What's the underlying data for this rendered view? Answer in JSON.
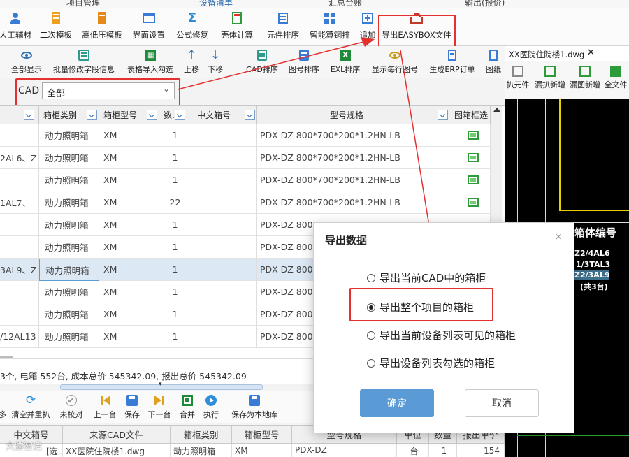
{
  "top_strip": {
    "items": [
      "项目管理",
      "设备清单",
      "汇总台账",
      "输出(报价)"
    ]
  },
  "ribbon1": {
    "buttons": [
      {
        "label": "人工辅材",
        "icon": "person-icon"
      },
      {
        "label": "二次模板",
        "icon": "template-icon"
      },
      {
        "label": "高低压模板",
        "icon": "template-icon"
      },
      {
        "label": "界面设置",
        "icon": "window-icon"
      },
      {
        "label": "公式修复",
        "icon": "sigma-icon"
      },
      {
        "label": "壳体计算",
        "icon": "calculator-icon"
      },
      {
        "label": "元件排序",
        "icon": "list-icon"
      },
      {
        "label": "智能算铜排",
        "icon": "grid-icon"
      },
      {
        "label": "追加",
        "icon": "plus-icon"
      },
      {
        "label": "导出EASYBOX文件",
        "icon": "export-icon"
      }
    ]
  },
  "ribbon2": {
    "buttons": [
      {
        "label": "全部显示",
        "icon": "eye-icon"
      },
      {
        "label": "批量修改字段信息",
        "icon": "edit-icon"
      },
      {
        "label": "表格导入勾选",
        "icon": "excel-icon"
      },
      {
        "label": "上移",
        "icon": "arrow-up-icon"
      },
      {
        "label": "下移",
        "icon": "arrow-down-icon"
      },
      {
        "label": "CAD排序",
        "icon": "cad-icon"
      },
      {
        "label": "图号排序",
        "icon": "list-icon"
      },
      {
        "label": "EXL排序",
        "icon": "excel-icon"
      },
      {
        "label": "显示每行图号",
        "icon": "eye-icon"
      },
      {
        "label": "生成ERP订单",
        "icon": "document-icon"
      },
      {
        "label": "图纸",
        "icon": "document-icon"
      }
    ]
  },
  "filter": {
    "label": "CAD",
    "value": "全部"
  },
  "grid": {
    "headers": [
      "箱柜类别",
      "箱柜型号",
      "数...",
      "中文箱号",
      "型号规格",
      "图箱框选"
    ],
    "rows": [
      {
        "name": "",
        "category": "动力照明箱",
        "model": "XM",
        "qty": "1",
        "cn": "",
        "spec": "PDX-DZ 800*700*200*1.2HN-LB"
      },
      {
        "name": "2AL6、Z",
        "category": "动力照明箱",
        "model": "XM",
        "qty": "1",
        "cn": "",
        "spec": "PDX-DZ 800*700*200*1.2HN-LB"
      },
      {
        "name": "",
        "category": "动力照明箱",
        "model": "XM",
        "qty": "1",
        "cn": "",
        "spec": "PDX-DZ 800*700*200*1.2HN-LB"
      },
      {
        "name": "1AL7、",
        "category": "动力照明箱",
        "model": "XM",
        "qty": "22",
        "cn": "",
        "spec": "PDX-DZ 800*700*200*1.2HN-LB"
      },
      {
        "name": "",
        "category": "动力照明箱",
        "model": "XM",
        "qty": "1",
        "cn": "",
        "spec": "PDX-DZ 800"
      },
      {
        "name": "",
        "category": "动力照明箱",
        "model": "XM",
        "qty": "1",
        "cn": "",
        "spec": "PDX-DZ 800"
      },
      {
        "name": "3AL9、Z",
        "category": "动力照明箱",
        "model": "XM",
        "qty": "1",
        "cn": "",
        "spec": "PDX-DZ 800"
      },
      {
        "name": "",
        "category": "动力照明箱",
        "model": "XM",
        "qty": "1",
        "cn": "",
        "spec": "PDX-DZ 800"
      },
      {
        "name": "",
        "category": "动力照明箱",
        "model": "XM",
        "qty": "1",
        "cn": "",
        "spec": "PDX-DZ 800"
      },
      {
        "name": "/12AL13",
        "category": "动力照明箱",
        "model": "XM",
        "qty": "1",
        "cn": "",
        "spec": "PDX-DZ 800"
      }
    ]
  },
  "status": {
    "text": "3个, 电箱 552台, 成本总价 545342.09, 报出总价 545342.09"
  },
  "bottom_toolbar": {
    "buttons": [
      {
        "label": "多",
        "icon": "none"
      },
      {
        "label": "清空并重扒",
        "icon": "refresh-icon"
      },
      {
        "label": "未校对",
        "icon": "check-circle-icon"
      },
      {
        "label": "上一台",
        "icon": "first-icon"
      },
      {
        "label": "保存",
        "icon": "save-icon"
      },
      {
        "label": "下一台",
        "icon": "last-icon"
      },
      {
        "label": "合并",
        "icon": "merge-icon"
      },
      {
        "label": "执行",
        "icon": "play-icon"
      },
      {
        "label": "保存为本地库",
        "icon": "save-icon"
      }
    ]
  },
  "bottom_grid": {
    "headers": [
      "中文箱号",
      "来源CAD文件",
      "箱柜类别",
      "箱柜型号",
      "型号规格",
      "单位",
      "数量",
      "报出单价"
    ],
    "row": [
      "[选...",
      "XX医院住院楼1.dwg",
      "动力照明箱",
      "XM",
      "PDX-DZ",
      "台",
      "1",
      "154"
    ]
  },
  "cad": {
    "tab_title": "XX医院住院楼1.dwg",
    "tools": [
      "扒元件",
      "漏扒新增",
      "漏图新增",
      "全文件"
    ],
    "drawing_texts": [
      "箱体编号",
      "Z2/4AL6",
      "1/3TAL3",
      "Z2/3AL9",
      "(共3台)"
    ]
  },
  "dialog": {
    "title": "导出数据",
    "options": [
      "导出当前CAD中的箱柜",
      "导出整个项目的箱柜",
      "导出当前设备列表可见的箱柜",
      "导出设备列表勾选的箱柜"
    ],
    "selected_index": 1,
    "ok_label": "确定",
    "cancel_label": "取消"
  },
  "watermark": {
    "text": "大勝智造"
  },
  "colors": {
    "accent": "#5b9bd5",
    "annotation": "#e53030",
    "ok_button": "#5b9bd5",
    "selected_row": "#dde8f5"
  }
}
